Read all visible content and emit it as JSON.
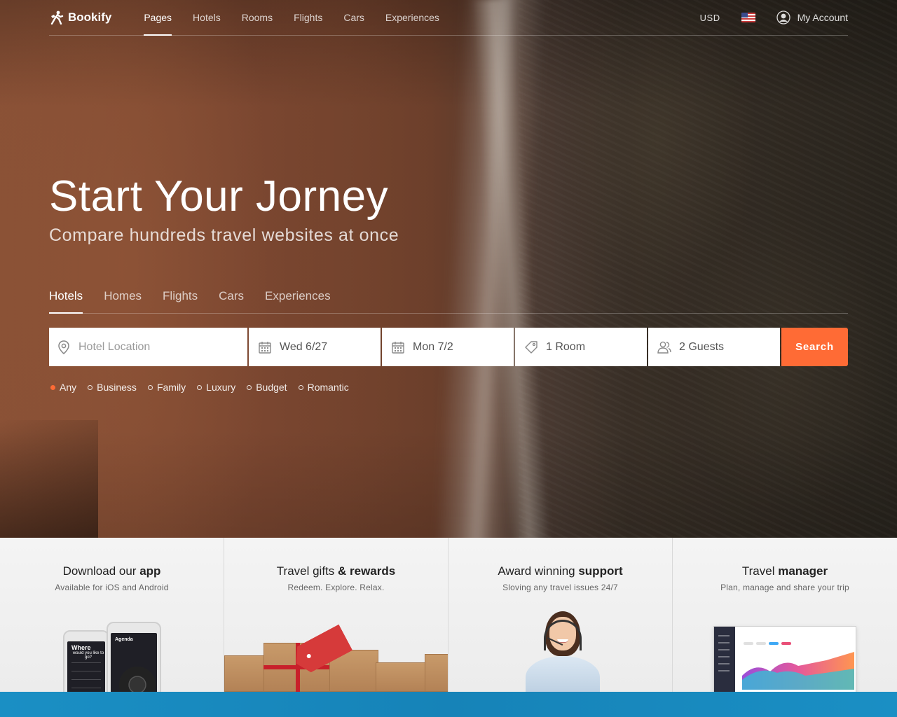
{
  "brand": {
    "name": "Bookify"
  },
  "nav": {
    "items": [
      {
        "label": "Pages",
        "active": true
      },
      {
        "label": "Hotels"
      },
      {
        "label": "Rooms"
      },
      {
        "label": "Flights"
      },
      {
        "label": "Cars"
      },
      {
        "label": "Experiences"
      }
    ],
    "currency": "USD",
    "flag_icon": "us-flag-icon",
    "account_label": "My Account"
  },
  "hero": {
    "title": "Start Your Jorney",
    "subtitle": "Compare hundreds travel websites at once"
  },
  "search_tabs": [
    {
      "label": "Hotels",
      "active": true
    },
    {
      "label": "Homes"
    },
    {
      "label": "Flights"
    },
    {
      "label": "Cars"
    },
    {
      "label": "Experiences"
    }
  ],
  "search": {
    "location_placeholder": "Hotel Location",
    "checkin": "Wed 6/27",
    "checkout": "Mon 7/2",
    "rooms": "1 Room",
    "guests": "2 Guests",
    "button_label": "Search"
  },
  "filters": [
    {
      "label": "Any",
      "active": true
    },
    {
      "label": "Business"
    },
    {
      "label": "Family"
    },
    {
      "label": "Luxury"
    },
    {
      "label": "Budget"
    },
    {
      "label": "Romantic"
    }
  ],
  "features": [
    {
      "title_pre": "Download our ",
      "title_bold": "app",
      "subtitle": "Available for iOS and Android"
    },
    {
      "title_pre": "Travel gifts ",
      "title_bold": "& rewards",
      "subtitle": "Redeem. Explore. Relax."
    },
    {
      "title_pre": "Award winning ",
      "title_bold": "support",
      "subtitle": "Sloving any travel issues 24/7"
    },
    {
      "title_pre": "Travel ",
      "title_bold": "manager",
      "subtitle": "Plan, manage and share your trip"
    }
  ],
  "app_mockup": {
    "heading": "Where",
    "subheading": "would you like to go?",
    "agenda": "Agenda"
  },
  "colors": {
    "accent": "#ff6b35",
    "footer_strip": "#1a8fc4"
  }
}
